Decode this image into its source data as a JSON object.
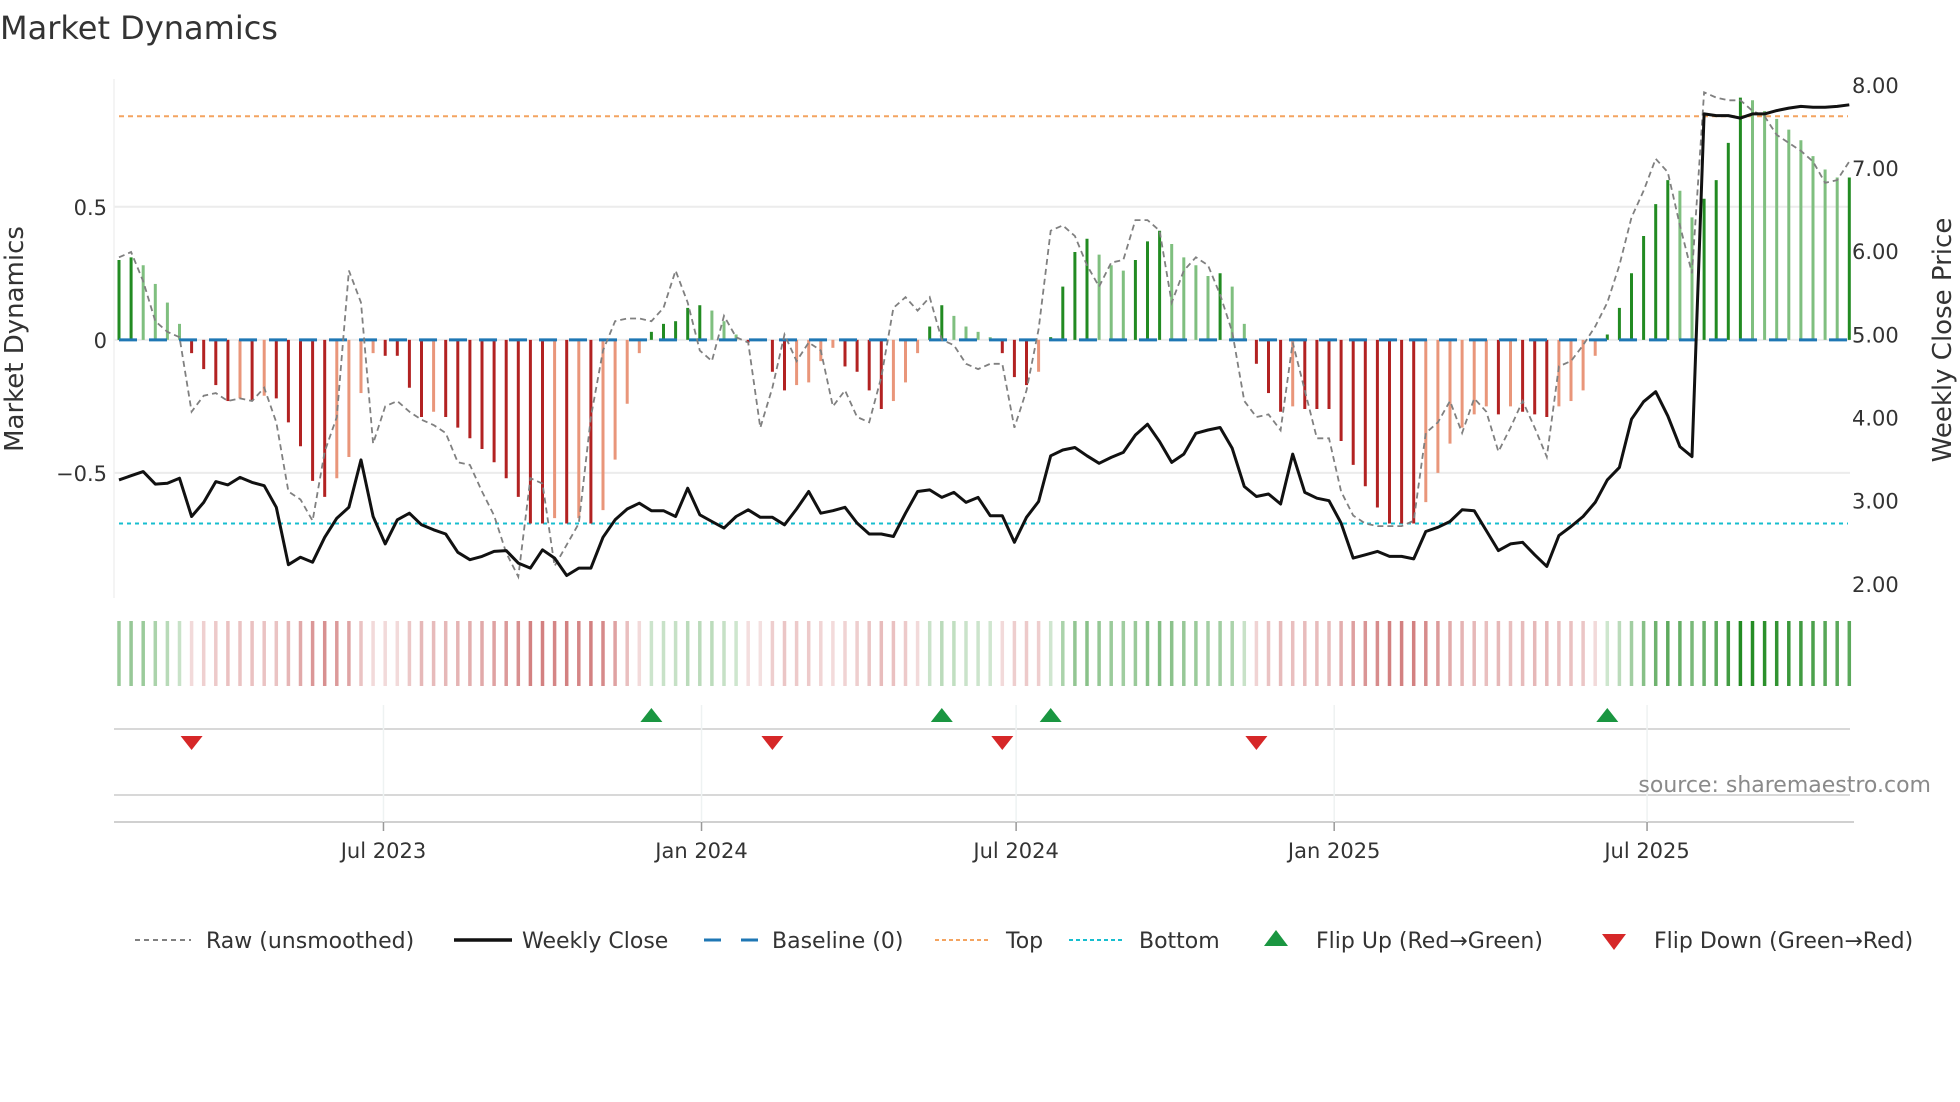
{
  "chart_data": {
    "type": "bar",
    "title": "Market Dynamics",
    "ylabel": "Market Dynamics",
    "y2label": "Weekly Close Price",
    "ylim": [
      -0.97,
      0.98
    ],
    "y2lim": [
      1.83,
      8.07
    ],
    "yticks": [
      {
        "v": 0.5,
        "label": "0.5"
      },
      {
        "v": 0,
        "label": "0"
      },
      {
        "v": -0.5,
        "label": "−0.5"
      }
    ],
    "y2ticks": [
      {
        "v": 8,
        "label": "8.00"
      },
      {
        "v": 7,
        "label": "7.00"
      },
      {
        "v": 6,
        "label": "6.00"
      },
      {
        "v": 5,
        "label": "5.00"
      },
      {
        "v": 4,
        "label": "4.00"
      },
      {
        "v": 3,
        "label": "3.00"
      },
      {
        "v": 2,
        "label": "2.00"
      }
    ],
    "x_start": "2023-01-29",
    "x_frequency": "weekly",
    "xticks": [
      {
        "date": "2023-07-01",
        "label": "Jul 2023"
      },
      {
        "date": "2024-01-01",
        "label": "Jan 2024"
      },
      {
        "date": "2024-07-01",
        "label": "Jul 2024"
      },
      {
        "date": "2025-01-01",
        "label": "Jan 2025"
      },
      {
        "date": "2025-07-01",
        "label": "Jul 2025"
      }
    ],
    "top_level": 0.84,
    "bottom_level": -0.69,
    "baseline": 0,
    "series": [
      {
        "name": "Market Dynamics (smoothed)",
        "kind": "bar",
        "values": [
          0.3,
          0.31,
          0.28,
          0.21,
          0.14,
          0.06,
          -0.05,
          -0.11,
          -0.17,
          -0.23,
          -0.22,
          -0.23,
          -0.21,
          -0.22,
          -0.31,
          -0.4,
          -0.53,
          -0.59,
          -0.52,
          -0.44,
          -0.2,
          -0.05,
          -0.06,
          -0.06,
          -0.18,
          -0.29,
          -0.27,
          -0.29,
          -0.33,
          -0.37,
          -0.41,
          -0.46,
          -0.52,
          -0.59,
          -0.69,
          -0.69,
          -0.67,
          -0.69,
          -0.67,
          -0.69,
          -0.64,
          -0.45,
          -0.24,
          -0.05,
          0.03,
          0.06,
          0.07,
          0.12,
          0.13,
          0.11,
          0.07,
          0.02,
          -0.01,
          -0.005,
          -0.12,
          -0.19,
          -0.17,
          -0.16,
          -0.08,
          -0.03,
          -0.1,
          -0.12,
          -0.19,
          -0.26,
          -0.23,
          -0.16,
          -0.05,
          0.05,
          0.13,
          0.09,
          0.05,
          0.03,
          0.01,
          -0.05,
          -0.14,
          -0.17,
          -0.12,
          0.01,
          0.2,
          0.33,
          0.38,
          0.32,
          0.28,
          0.26,
          0.3,
          0.37,
          0.41,
          0.36,
          0.31,
          0.28,
          0.24,
          0.25,
          0.2,
          0.06,
          -0.09,
          -0.2,
          -0.27,
          -0.25,
          -0.26,
          -0.26,
          -0.26,
          -0.38,
          -0.47,
          -0.55,
          -0.63,
          -0.69,
          -0.69,
          -0.69,
          -0.61,
          -0.5,
          -0.39,
          -0.33,
          -0.28,
          -0.25,
          -0.28,
          -0.25,
          -0.27,
          -0.28,
          -0.29,
          -0.25,
          -0.23,
          -0.19,
          -0.06,
          0.02,
          0.12,
          0.25,
          0.39,
          0.51,
          0.6,
          0.56,
          0.46,
          0.53,
          0.6,
          0.74,
          0.91,
          0.9,
          0.86,
          0.83,
          0.79,
          0.75,
          0.69,
          0.64,
          0.61,
          0.61
        ]
      },
      {
        "name": "Raw (unsmoothed)",
        "kind": "line",
        "values": [
          0.31,
          0.33,
          0.22,
          0.07,
          0.03,
          0.01,
          -0.27,
          -0.21,
          -0.2,
          -0.23,
          -0.22,
          -0.23,
          -0.18,
          -0.31,
          -0.57,
          -0.6,
          -0.68,
          -0.42,
          -0.29,
          0.26,
          0.14,
          -0.39,
          -0.25,
          -0.23,
          -0.27,
          -0.3,
          -0.32,
          -0.35,
          -0.46,
          -0.47,
          -0.57,
          -0.66,
          -0.8,
          -0.89,
          -0.52,
          -0.54,
          -0.85,
          -0.77,
          -0.69,
          -0.29,
          -0.04,
          0.07,
          0.08,
          0.08,
          0.07,
          0.12,
          0.26,
          0.14,
          -0.04,
          -0.08,
          0.09,
          0.01,
          -0.01,
          -0.33,
          -0.18,
          0.02,
          -0.08,
          -0.01,
          -0.04,
          -0.25,
          -0.19,
          -0.29,
          -0.31,
          -0.14,
          0.12,
          0.16,
          0.11,
          0.16,
          0.0,
          -0.02,
          -0.09,
          -0.11,
          -0.09,
          -0.09,
          -0.33,
          -0.19,
          0.04,
          0.41,
          0.43,
          0.39,
          0.28,
          0.2,
          0.29,
          0.3,
          0.45,
          0.45,
          0.41,
          0.14,
          0.26,
          0.31,
          0.28,
          0.17,
          0.03,
          -0.23,
          -0.29,
          -0.28,
          -0.34,
          -0.01,
          -0.19,
          -0.37,
          -0.37,
          -0.57,
          -0.66,
          -0.69,
          -0.7,
          -0.7,
          -0.7,
          -0.68,
          -0.35,
          -0.31,
          -0.23,
          -0.35,
          -0.22,
          -0.27,
          -0.42,
          -0.33,
          -0.23,
          -0.33,
          -0.44,
          -0.1,
          -0.08,
          -0.02,
          0.05,
          0.14,
          0.28,
          0.46,
          0.56,
          0.68,
          0.63,
          0.43,
          0.25,
          0.93,
          0.91,
          0.9,
          0.9,
          0.86,
          0.84,
          0.77,
          0.74,
          0.71,
          0.67,
          0.59,
          0.6,
          0.67
        ]
      },
      {
        "name": "Weekly Close",
        "kind": "line",
        "axis": "right",
        "values": [
          3.25,
          3.3,
          3.35,
          3.2,
          3.21,
          3.27,
          2.81,
          2.98,
          3.23,
          3.19,
          3.28,
          3.22,
          3.18,
          2.92,
          2.23,
          2.32,
          2.26,
          2.56,
          2.79,
          2.92,
          3.49,
          2.81,
          2.48,
          2.77,
          2.85,
          2.71,
          2.65,
          2.6,
          2.38,
          2.29,
          2.33,
          2.39,
          2.4,
          2.25,
          2.19,
          2.41,
          2.31,
          2.1,
          2.19,
          2.19,
          2.56,
          2.77,
          2.9,
          2.97,
          2.88,
          2.88,
          2.81,
          3.15,
          2.83,
          2.75,
          2.67,
          2.81,
          2.89,
          2.8,
          2.8,
          2.71,
          2.9,
          3.11,
          2.85,
          2.88,
          2.92,
          2.73,
          2.6,
          2.6,
          2.57,
          2.85,
          3.11,
          3.13,
          3.04,
          3.1,
          2.98,
          3.04,
          2.82,
          2.82,
          2.5,
          2.8,
          2.99,
          3.54,
          3.61,
          3.64,
          3.54,
          3.45,
          3.52,
          3.58,
          3.79,
          3.92,
          3.71,
          3.46,
          3.56,
          3.81,
          3.85,
          3.88,
          3.63,
          3.17,
          3.05,
          3.08,
          2.96,
          3.56,
          3.1,
          3.03,
          3.0,
          2.73,
          2.31,
          2.35,
          2.39,
          2.33,
          2.33,
          2.3,
          2.63,
          2.68,
          2.75,
          2.89,
          2.88,
          2.64,
          2.4,
          2.48,
          2.5,
          2.35,
          2.21,
          2.58,
          2.69,
          2.81,
          2.98,
          3.25,
          3.4,
          3.98,
          4.19,
          4.31,
          4.02,
          3.65,
          3.53,
          7.65,
          7.63,
          7.63,
          7.6,
          7.65,
          7.65,
          7.69,
          7.72,
          7.74,
          7.73,
          7.73,
          7.74,
          7.76
        ]
      }
    ],
    "flips": {
      "up_indices": [
        44,
        68,
        77,
        123
      ],
      "down_indices": [
        6,
        54,
        73,
        94
      ]
    },
    "legend": {
      "placement": "bottom",
      "items": [
        {
          "label": "Raw (unsmoothed)",
          "style": "raw"
        },
        {
          "label": "Weekly Close",
          "style": "close"
        },
        {
          "label": "Baseline (0)",
          "style": "baseline"
        },
        {
          "label": "Top",
          "style": "top"
        },
        {
          "label": "Bottom",
          "style": "bottom"
        },
        {
          "label": "Flip Up (Red→Green)",
          "style": "up"
        },
        {
          "label": "Flip Down (Green→Red)",
          "style": "down"
        }
      ]
    },
    "source": "source: sharemaestro.com",
    "colors": {
      "green_strong": "#228b22",
      "green_light": "#7fbf7f",
      "red_strong": "#b22222",
      "red_light": "#e9967a",
      "raw": "#808080",
      "close": "#111111",
      "baseline": "#1f77b4",
      "top": "#f4a460",
      "bottom": "#17becf",
      "flip_up": "#1a9641",
      "flip_down": "#d62728"
    }
  }
}
